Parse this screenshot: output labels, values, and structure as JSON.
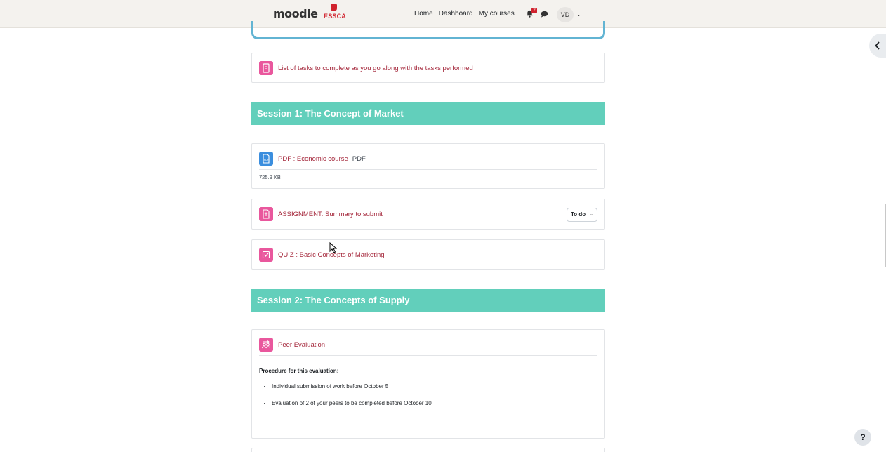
{
  "header": {
    "logo_text": "moodle",
    "brand_text": "ESSCA",
    "nav": [
      "Home",
      "Dashboard",
      "My courses"
    ],
    "notifications_count": "2",
    "user_initials": "VD"
  },
  "activities": {
    "tasks_list": {
      "label": "List of tasks to complete as you go along with the tasks performed"
    },
    "session1": {
      "title": "Session 1: The Concept of Market",
      "pdf": {
        "label": "PDF : Economic course",
        "type": "PDF",
        "size": "725.9 KB"
      },
      "assignment": {
        "label": "ASSIGNMENT: Summary to submit",
        "status": "To do"
      },
      "quiz": {
        "label": "QUIZ : Basic Concepts of Marketing"
      }
    },
    "session2": {
      "title": "Session 2: The Concepts of Supply",
      "peer": {
        "label": "Peer Evaluation",
        "procedure_title": "Procedure for this evaluation:",
        "steps": [
          "Individual submission of work before October 5",
          "Evaluation of 2 of your peers to be completed before October 10"
        ]
      }
    }
  },
  "help_label": "?",
  "colors": {
    "section_header": "#62cfbb",
    "activity_icon": "#e9579d",
    "resource_icon": "#3b8ede",
    "link": "#a4263a"
  }
}
